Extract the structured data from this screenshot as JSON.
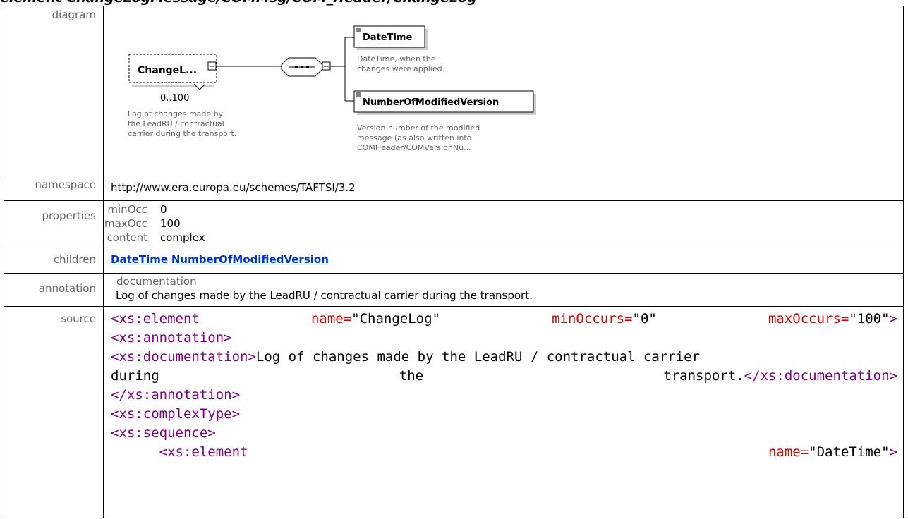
{
  "heading": "element ChangeLogMessage/COMMsg/COM_Header/ChangeLog",
  "labels": {
    "diagram": "diagram",
    "namespace": "namespace",
    "properties": "properties",
    "children": "children",
    "annotation": "annotation",
    "source": "source"
  },
  "diagram": {
    "root_name": "ChangeL...",
    "root_occurs": "0..100",
    "root_doc": [
      "Log of changes made by",
      "the LeadRU / contractual",
      "carrier during the transport."
    ],
    "child1_name": "DateTime",
    "child1_doc": [
      "DateTime, when the",
      "changes were applied."
    ],
    "child2_name": "NumberOfModifiedVersion",
    "child2_doc": [
      "Version number of the modified",
      "message (as also written into",
      "COMHeader/COMVersionNu..."
    ]
  },
  "namespace": "http://www.era.europa.eu/schemes/TAFTSI/3.2",
  "properties": [
    {
      "key": "minOcc",
      "value": "0"
    },
    {
      "key": "maxOcc",
      "value": "100"
    },
    {
      "key": "content",
      "value": "complex"
    }
  ],
  "children": [
    "DateTime",
    "NumberOfModifiedVersion"
  ],
  "annotation": {
    "key": "documentation",
    "text": "Log of changes made by the LeadRU / contractual carrier during the transport."
  },
  "source": {
    "l1_open": "<xs:element",
    "l1_name_attr": "name=",
    "l1_name_val": "\"ChangeLog\"",
    "l1_min_attr": "minOccurs=",
    "l1_min_val": "\"0\"",
    "l1_max_attr": "maxOccurs=",
    "l1_max_val": "\"100\"",
    "l1_close": ">",
    "l2": "<xs:annotation>",
    "l3_open": "<xs:documentation>",
    "l3_text": "Log of changes made by the LeadRU / contractual carrier",
    "l4_w1": "during",
    "l4_w2": "the",
    "l4_w3": "transport.",
    "l4_close": "</xs:documentation>",
    "l5": "</xs:annotation>",
    "l6": "<xs:complexType>",
    "l7": "<xs:sequence>",
    "l8_open": "<xs:element",
    "l8_attr": "name=",
    "l8_val": "\"DateTime\"",
    "l8_close": ">"
  },
  "colors": {
    "link": "#0033cc",
    "tag": "#800080",
    "attr": "#e00000",
    "label": "#666666"
  }
}
